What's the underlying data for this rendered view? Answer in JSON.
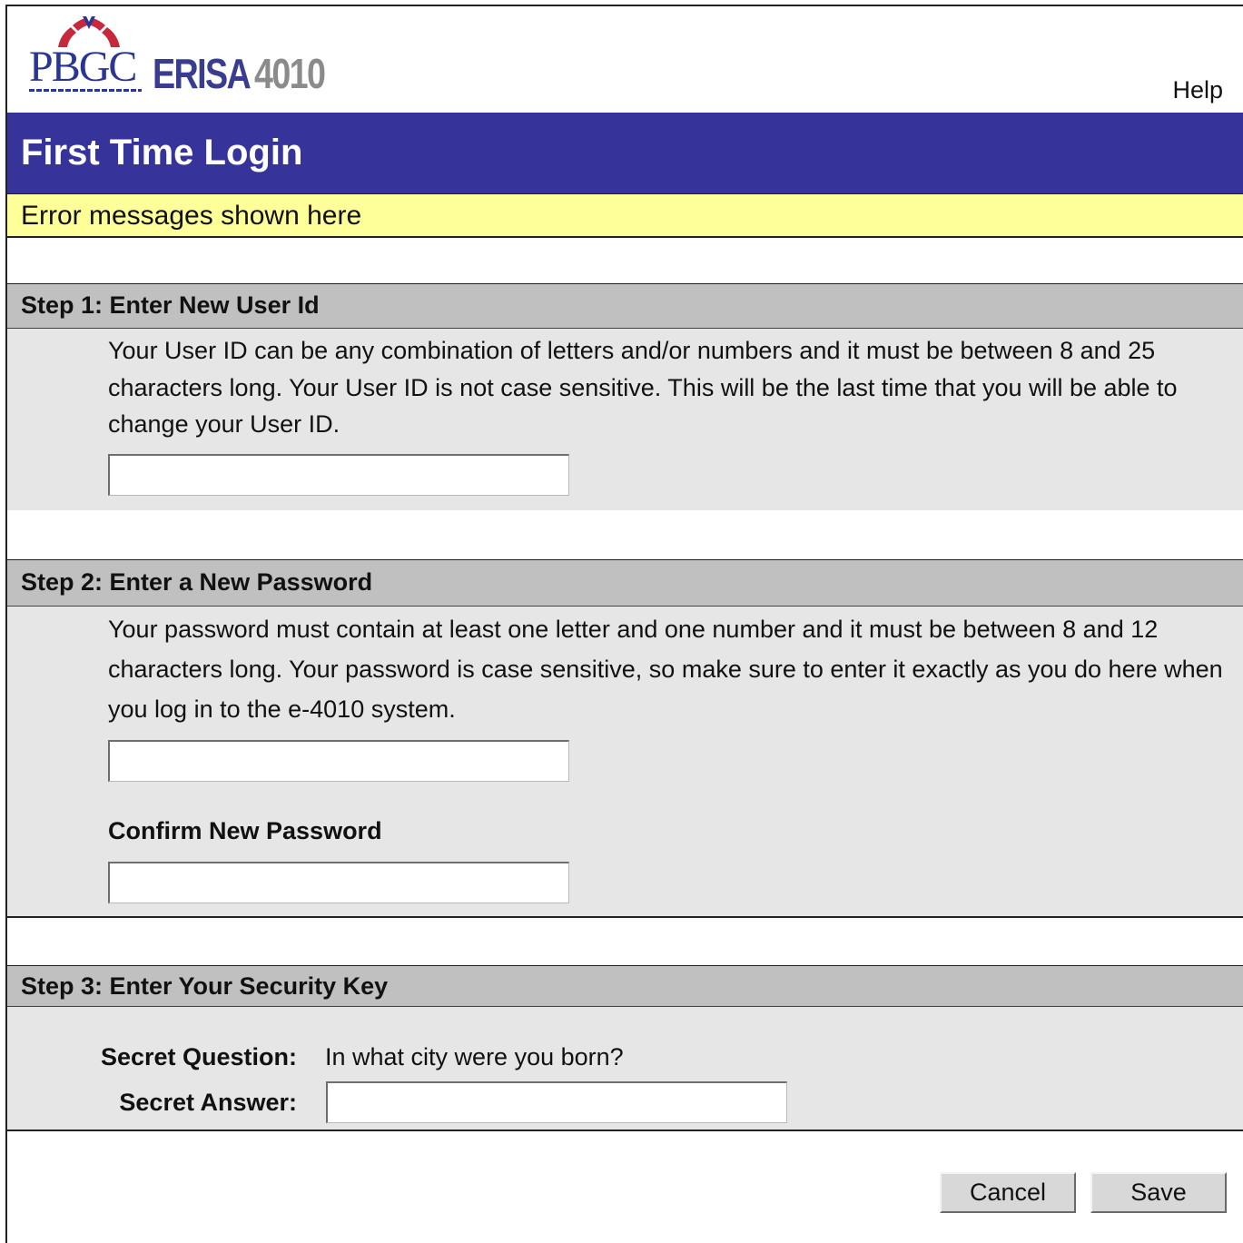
{
  "header": {
    "logo_primary": "PBGC",
    "logo_product": "ERISA",
    "logo_number": "4010",
    "help_label": "Help"
  },
  "page": {
    "title": "First Time Login",
    "error_message": "Error messages shown here"
  },
  "step1": {
    "heading": "Step 1: Enter New User Id",
    "description": "Your User ID can be any combination of letters and/or numbers and it must be between 8 and 25 characters long. Your User ID is not case sensitive. This will be the last time that you will be able to change your User ID.",
    "user_id_value": ""
  },
  "step2": {
    "heading": "Step 2: Enter a New Password",
    "description": "Your password must contain at least one letter and one number and it must be between 8 and 12  characters long. Your password is case sensitive, so make sure to enter it exactly as you do here  when you log in to the e-4010 system.",
    "password_value": "",
    "confirm_label": "Confirm New Password",
    "confirm_value": ""
  },
  "step3": {
    "heading": "Step 3: Enter Your Security Key",
    "question_label": "Secret Question:",
    "question_text": "In what city were you born?",
    "answer_label": "Secret Answer:",
    "answer_value": ""
  },
  "actions": {
    "cancel_label": "Cancel",
    "save_label": "Save"
  },
  "colors": {
    "title_bar": "#36349a",
    "error_bar": "#ffff99",
    "step_header": "#c0c0c0",
    "panel": "#e6e6e6",
    "logo_red": "#c8283c",
    "logo_blue": "#2b3592"
  }
}
